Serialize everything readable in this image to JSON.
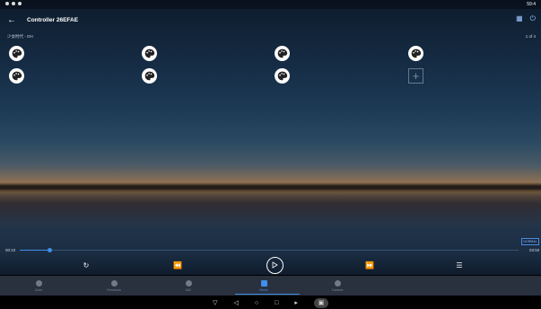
{
  "status_bar": {
    "left_icons": [
      "dot-icon",
      "dot-icon",
      "dot-icon"
    ],
    "right_text": "59:4"
  },
  "app_bar": {
    "back_icon": "back-arrow-icon",
    "title": "Controller 26EFAE",
    "right_icons": [
      "grid-icon",
      "power-icon"
    ]
  },
  "group_label": "少女时代 - OH",
  "page_indicator": "1 of 4",
  "buttons": [
    {
      "icon": "palette-icon"
    },
    {
      "icon": "palette-icon"
    },
    {
      "icon": "palette-icon"
    },
    {
      "icon": "palette-icon"
    },
    {
      "icon": "palette-icon"
    },
    {
      "icon": "palette-icon"
    },
    {
      "icon": "palette-icon"
    },
    {
      "icon": "plus-icon"
    }
  ],
  "player": {
    "elapsed": "00:10",
    "total": "03:50",
    "progress": 0.06,
    "mode_label": "NORMAL"
  },
  "controls": [
    "repeat-icon",
    "rewind-icon",
    "play-icon",
    "fast-forward-icon",
    "playlist-icon"
  ],
  "tabs": [
    {
      "label": "Color",
      "icon": "color-icon"
    },
    {
      "label": "Functions",
      "icon": "functions-icon"
    },
    {
      "label": "MIC",
      "icon": "mic-icon"
    },
    {
      "label": "Music",
      "icon": "music-icon",
      "active": true
    },
    {
      "label": "Camera",
      "icon": "camera-icon"
    }
  ],
  "nav": [
    "volume-down-icon",
    "back-icon",
    "home-icon",
    "recents-icon",
    "volume-up-icon",
    "screenshot-icon"
  ],
  "colors": {
    "accent": "#3f8fe8",
    "tab_bg": "#2b3341"
  }
}
